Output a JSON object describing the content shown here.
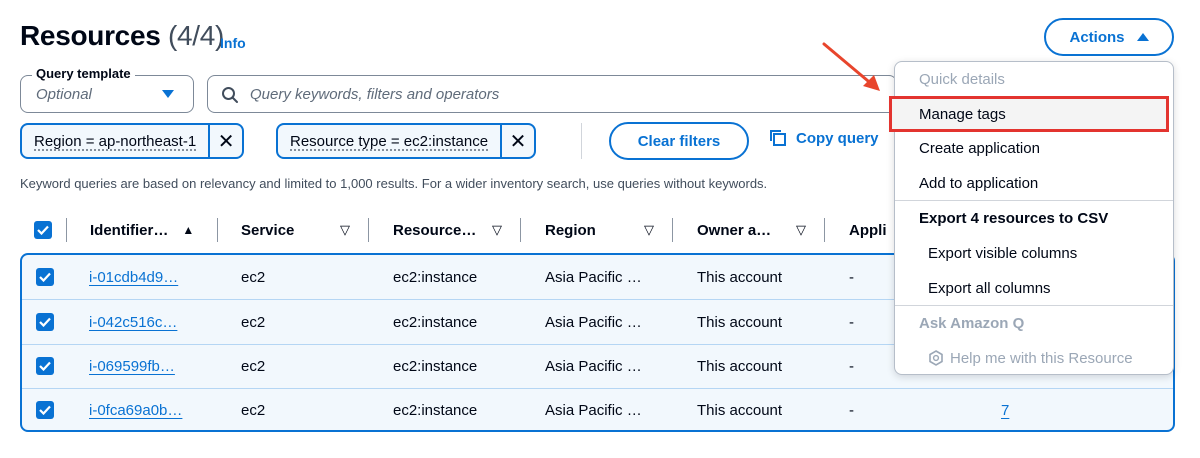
{
  "header": {
    "title": "Resources",
    "count": "(4/4)",
    "info": "Info",
    "actions_label": "Actions"
  },
  "query_template": {
    "label": "Query template",
    "value": "Optional"
  },
  "search": {
    "placeholder": "Query keywords, filters and operators"
  },
  "filters": [
    {
      "label": "Region = ap-northeast-1"
    },
    {
      "label": "Resource type = ec2:instance"
    }
  ],
  "clear_filters_label": "Clear filters",
  "copy_query_label": "Copy query",
  "hint": "Keyword queries are based on relevancy and limited to 1,000 results. For a wider inventory search, use queries without keywords.",
  "table": {
    "columns": [
      "Identifier…",
      "Service",
      "Resource…",
      "Region",
      "Owner a…",
      "Appli"
    ],
    "rows": [
      {
        "id": "i-01cdb4d9…",
        "service": "ec2",
        "type": "ec2:instance",
        "region": "Asia Pacific …",
        "owner": "This account",
        "app": "-",
        "tags": ""
      },
      {
        "id": "i-042c516c…",
        "service": "ec2",
        "type": "ec2:instance",
        "region": "Asia Pacific …",
        "owner": "This account",
        "app": "-",
        "tags": ""
      },
      {
        "id": "i-069599fb…",
        "service": "ec2",
        "type": "ec2:instance",
        "region": "Asia Pacific …",
        "owner": "This account",
        "app": "-",
        "tags": ""
      },
      {
        "id": "i-0fca69a0b…",
        "service": "ec2",
        "type": "ec2:instance",
        "region": "Asia Pacific …",
        "owner": "This account",
        "app": "-",
        "tags": "7"
      }
    ]
  },
  "menu": {
    "quick_details": "Quick details",
    "manage_tags": "Manage tags",
    "create_application": "Create application",
    "add_to_application": "Add to application",
    "export_csv": "Export 4 resources to CSV",
    "export_visible": "Export visible columns",
    "export_all": "Export all columns",
    "ask_q": "Ask Amazon Q",
    "help_resource": "Help me with this Resource"
  },
  "colors": {
    "accent": "#0972d3",
    "highlight_box": "#e3342f",
    "annotation_arrow": "#e8452c"
  }
}
